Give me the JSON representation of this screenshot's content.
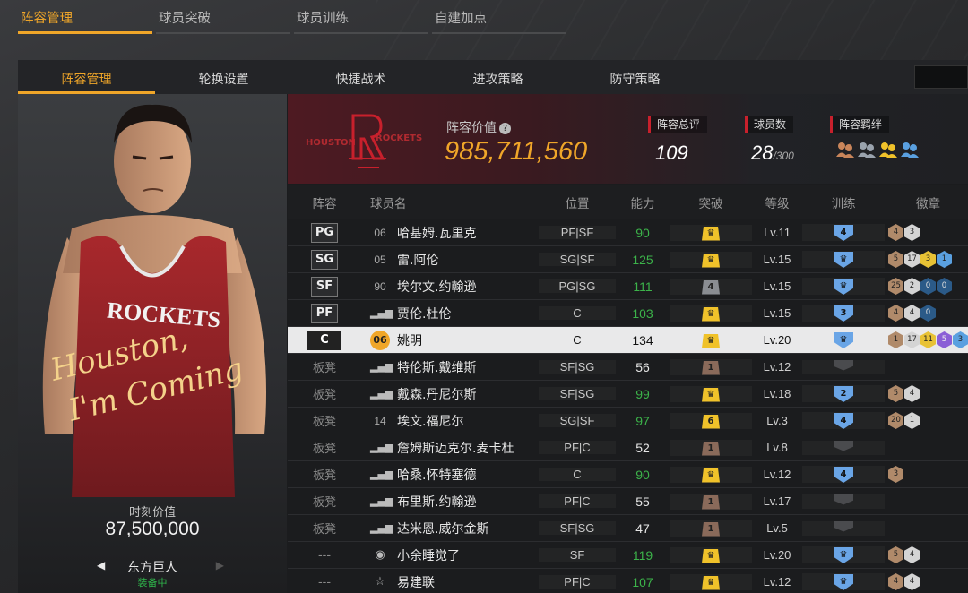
{
  "top_tabs": [
    "阵容管理",
    "球员突破",
    "球员训练",
    "自建加点"
  ],
  "sub_tabs": [
    "阵容管理",
    "轮换设置",
    "快捷战术",
    "进攻策略",
    "防守策略"
  ],
  "card": {
    "slogan_line1": "Houston,",
    "slogan_line2": "I'm Coming",
    "jersey_text": "ROCKETS",
    "value_label": "时刻价值",
    "value": "87,500,000",
    "skill_name": "东方巨人",
    "skill_status": "装备中"
  },
  "team": {
    "logo_text_left": "HOUSTON",
    "logo_text_right": "ROCKETS",
    "value_label": "阵容价值",
    "help_icon": "?",
    "value": "985,711,560",
    "rating_label": "阵容总评",
    "rating": "109",
    "players_label": "球员数",
    "players": "28",
    "players_max": "/300",
    "bonds_label": "阵容羁绊",
    "bond_colors": [
      "#c9855a",
      "#9aa3ad",
      "#f0c22a",
      "#5aa0e0"
    ]
  },
  "columns": [
    "阵容",
    "球员名",
    "位置",
    "能力",
    "突破",
    "等级",
    "训练",
    "徽章"
  ],
  "rows": [
    {
      "slot": "PG",
      "num": "06",
      "numtype": "num",
      "name": "哈基姆.瓦里克",
      "pos": "PF|SF",
      "ability": "90",
      "abilityColor": "green",
      "bk": "gold",
      "bkText": "",
      "lv": "Lv.11",
      "train": "4",
      "trainType": "blue",
      "badges": [
        [
          "br",
          "4"
        ],
        [
          "si",
          "3"
        ]
      ]
    },
    {
      "slot": "SG",
      "num": "05",
      "numtype": "num",
      "name": "雷.阿伦",
      "pos": "SG|SF",
      "ability": "125",
      "abilityColor": "green",
      "bk": "gold",
      "bkText": "",
      "lv": "Lv.15",
      "train": "",
      "trainType": "blue",
      "badges": [
        [
          "br",
          "5"
        ],
        [
          "si",
          "17"
        ],
        [
          "go",
          "3"
        ],
        [
          "cy",
          "1"
        ]
      ]
    },
    {
      "slot": "SF",
      "num": "90",
      "numtype": "num",
      "name": "埃尔文.约翰逊",
      "pos": "PG|SG",
      "ability": "111",
      "abilityColor": "green",
      "bk": "gray",
      "bkText": "4",
      "lv": "Lv.15",
      "train": "",
      "trainType": "blue",
      "badges": [
        [
          "br",
          "25"
        ],
        [
          "si",
          "2"
        ],
        [
          "bl",
          "0"
        ],
        [
          "bl",
          "0"
        ]
      ]
    },
    {
      "slot": "PF",
      "num": "",
      "numtype": "bars",
      "name": "贾伦.杜伦",
      "pos": "C",
      "ability": "103",
      "abilityColor": "green",
      "bk": "gold",
      "bkText": "",
      "lv": "Lv.15",
      "train": "3",
      "trainType": "blue",
      "badges": [
        [
          "br",
          "4"
        ],
        [
          "si",
          "4"
        ],
        [
          "bl",
          "0"
        ]
      ]
    },
    {
      "slot": "C",
      "num": "06",
      "numtype": "circle",
      "name": "姚明",
      "pos": "C",
      "ability": "134",
      "abilityColor": "",
      "bk": "gold",
      "bkText": "",
      "lv": "Lv.20",
      "train": "",
      "trainType": "blue",
      "badges": [
        [
          "br",
          "1"
        ],
        [
          "si",
          "17"
        ],
        [
          "go",
          "11"
        ],
        [
          "pu",
          "5"
        ],
        [
          "cy",
          "3"
        ]
      ],
      "selected": true
    },
    {
      "slot": "板凳",
      "num": "",
      "numtype": "bars",
      "name": "特伦斯.戴维斯",
      "pos": "SF|SG",
      "ability": "56",
      "abilityColor": "",
      "bk": "brown",
      "bkText": "1",
      "lv": "Lv.12",
      "train": "",
      "trainType": "dark",
      "badges": []
    },
    {
      "slot": "板凳",
      "num": "",
      "numtype": "bars",
      "name": "戴森.丹尼尔斯",
      "pos": "SF|SG",
      "ability": "99",
      "abilityColor": "green",
      "bk": "gold",
      "bkText": "",
      "lv": "Lv.18",
      "train": "2",
      "trainType": "blue",
      "badges": [
        [
          "br",
          "5"
        ],
        [
          "si",
          "4"
        ]
      ]
    },
    {
      "slot": "板凳",
      "num": "14",
      "numtype": "num",
      "name": "埃文.福尼尔",
      "pos": "SG|SF",
      "ability": "97",
      "abilityColor": "green",
      "bk": "gold",
      "bkText": "6",
      "lv": "Lv.3",
      "train": "4",
      "trainType": "blue",
      "badges": [
        [
          "br",
          "20"
        ],
        [
          "si",
          "1"
        ]
      ]
    },
    {
      "slot": "板凳",
      "num": "",
      "numtype": "bars",
      "name": "詹姆斯迈克尔.麦卡杜",
      "pos": "PF|C",
      "ability": "52",
      "abilityColor": "",
      "bk": "brown",
      "bkText": "1",
      "lv": "Lv.8",
      "train": "",
      "trainType": "dark",
      "badges": []
    },
    {
      "slot": "板凳",
      "num": "",
      "numtype": "bars",
      "name": "哈桑.怀特塞德",
      "pos": "C",
      "ability": "90",
      "abilityColor": "green",
      "bk": "gold",
      "bkText": "",
      "lv": "Lv.12",
      "train": "4",
      "trainType": "blue",
      "badges": [
        [
          "br",
          "3"
        ]
      ]
    },
    {
      "slot": "板凳",
      "num": "",
      "numtype": "bars",
      "name": "布里斯.约翰逊",
      "pos": "PF|C",
      "ability": "55",
      "abilityColor": "",
      "bk": "brown",
      "bkText": "1",
      "lv": "Lv.17",
      "train": "",
      "trainType": "dark",
      "badges": []
    },
    {
      "slot": "板凳",
      "num": "",
      "numtype": "bars",
      "name": "达米恩.威尔金斯",
      "pos": "SF|SG",
      "ability": "47",
      "abilityColor": "",
      "bk": "brown",
      "bkText": "1",
      "lv": "Lv.5",
      "train": "",
      "trainType": "dark",
      "badges": []
    },
    {
      "slot": "---",
      "num": "",
      "numtype": "avatar",
      "name": "小余睡觉了",
      "pos": "SF",
      "ability": "119",
      "abilityColor": "green",
      "bk": "gold",
      "bkText": "",
      "lv": "Lv.20",
      "train": "",
      "trainType": "blue",
      "badges": [
        [
          "br",
          "5"
        ],
        [
          "si",
          "4"
        ]
      ]
    },
    {
      "slot": "---",
      "num": "",
      "numtype": "star",
      "name": "易建联",
      "pos": "PF|C",
      "ability": "107",
      "abilityColor": "green",
      "bk": "gold",
      "bkText": "",
      "lv": "Lv.12",
      "train": "",
      "trainType": "blue",
      "badges": [
        [
          "br",
          "4"
        ],
        [
          "si",
          "4"
        ]
      ]
    }
  ]
}
